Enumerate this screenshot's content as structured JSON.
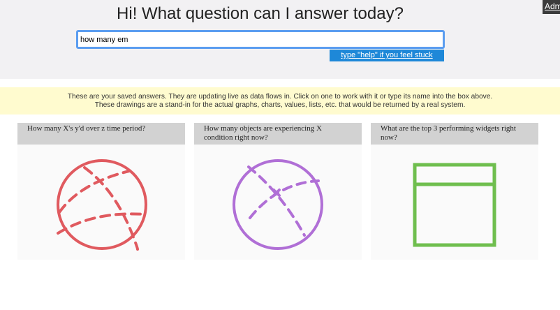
{
  "admin": {
    "label": "Admin"
  },
  "hero": {
    "title": "Hi! What question can I answer today?"
  },
  "search": {
    "value": "how many em",
    "placeholder": ""
  },
  "help_button": {
    "label": "type \"help\" if you feel stuck"
  },
  "notice": {
    "line1": "These are your saved answers. They are updating live as data flows in. Click on one to work with it or type its name into the box above.",
    "line2": "These drawings are a stand-in for the actual graphs, charts, values, lists, etc. that would be returned by a real system."
  },
  "cards": [
    {
      "title": "How many X's y'd over z time period?",
      "icon": "red-globe-sketch",
      "color": "#e05a5f"
    },
    {
      "title": "How many objects are experiencing X condition right now?",
      "icon": "purple-globe-sketch",
      "color": "#b06fd6"
    },
    {
      "title": "What are the top 3 performing widgets right now?",
      "icon": "green-table-sketch",
      "color": "#6fbe4e"
    }
  ]
}
